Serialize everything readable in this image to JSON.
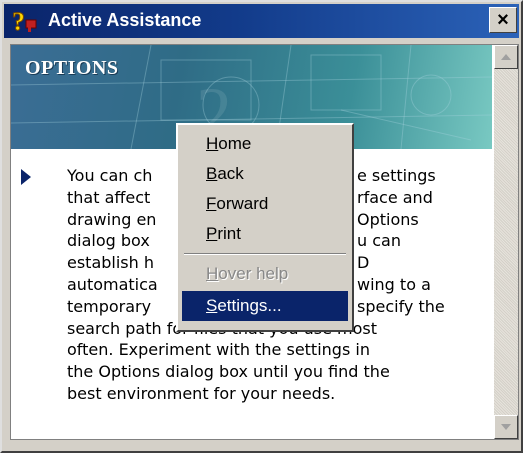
{
  "window": {
    "title": "Active Assistance",
    "close_label": "×"
  },
  "banner": {
    "title": "OPTIONS"
  },
  "body_lines": [
    "You can ch",
    "that affect",
    "drawing en",
    "dialog box",
    "establish h",
    "automatica",
    "temporary",
    "search path for files that you use most",
    "often. Experiment with the settings in",
    "the Options dialog box until you find the",
    "best environment for your needs."
  ],
  "body_right_fragments": [
    "e settings",
    "rface and",
    "Options",
    "u can",
    "D",
    "wing to a",
    "specify the"
  ],
  "context_menu": {
    "items": [
      {
        "key": "H",
        "rest": "ome",
        "state": "normal"
      },
      {
        "key": "B",
        "rest": "ack",
        "state": "normal"
      },
      {
        "key": "F",
        "rest": "orward",
        "state": "normal"
      },
      {
        "key": "P",
        "rest": "rint",
        "state": "normal"
      },
      {
        "key": "H",
        "rest": "over help",
        "state": "disabled"
      },
      {
        "key": "S",
        "rest": "ettings...",
        "state": "selected"
      }
    ]
  },
  "colors": {
    "title_bar": "#0a246a",
    "menu_highlight": "#0a246a",
    "bullet": "#0a246a"
  },
  "icons": {
    "title": "question-help-icon",
    "close": "close-icon"
  }
}
